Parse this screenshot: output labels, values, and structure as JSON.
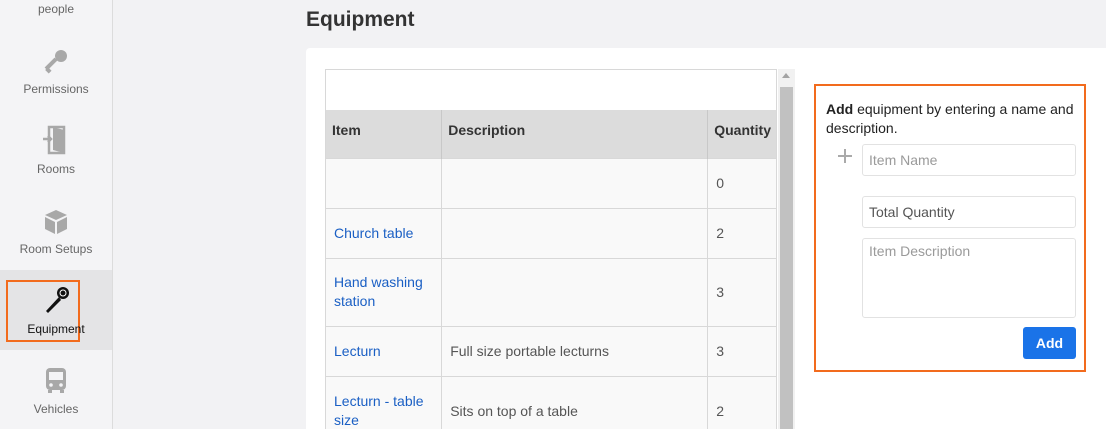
{
  "sidebar": {
    "items": [
      {
        "label": "people",
        "icon": "people-icon"
      },
      {
        "label": "Permissions",
        "icon": "key-icon"
      },
      {
        "label": "Rooms",
        "icon": "door-icon"
      },
      {
        "label": "Room Setups",
        "icon": "cube-icon"
      },
      {
        "label": "Equipment",
        "icon": "microphone-icon",
        "active": true
      },
      {
        "label": "Vehicles",
        "icon": "bus-icon"
      }
    ]
  },
  "page": {
    "title": "Equipment"
  },
  "table": {
    "columns": [
      "Item",
      "Description",
      "Quantity"
    ],
    "rows": [
      {
        "item": "",
        "description": "",
        "quantity": "0"
      },
      {
        "item": "Church table",
        "description": "",
        "quantity": "2"
      },
      {
        "item": "Hand washing station",
        "description": "",
        "quantity": "3"
      },
      {
        "item": "Lecturn",
        "description": "Full size portable lecturns",
        "quantity": "3"
      },
      {
        "item": "Lecturn - table size",
        "description": "Sits on top of a table",
        "quantity": "2"
      }
    ]
  },
  "add_form": {
    "intro_bold": "Add",
    "intro_rest": " equipment by entering a name and description.",
    "item_name_placeholder": "Item Name",
    "total_quantity_placeholder": "Total Quantity",
    "item_description_placeholder": "Item Description",
    "add_label": "Add"
  },
  "colors": {
    "highlight": "#f26b1d",
    "primary_button": "#1a73e8",
    "link": "#1a5fc4"
  }
}
